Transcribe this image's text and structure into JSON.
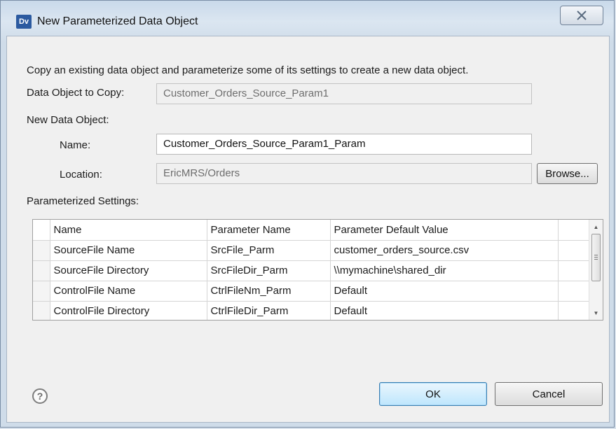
{
  "window": {
    "title": "New Parameterized Data Object",
    "app_icon_text": "Dv",
    "close_glyph": "X"
  },
  "dialog": {
    "description": "Copy an existing data object and parameterize some of its settings to create a new data object.",
    "copy_label": "Data Object to Copy:",
    "copy_value": "Customer_Orders_Source_Param1",
    "new_section_label": "New Data Object:",
    "name_label": "Name:",
    "name_value": "Customer_Orders_Source_Param1_Param",
    "location_label": "Location:",
    "location_value": "EricMRS/Orders",
    "browse_label": "Browse...",
    "settings_label": "Parameterized Settings:"
  },
  "table": {
    "columns": [
      "Name",
      "Parameter Name",
      "Parameter Default Value"
    ],
    "rows": [
      [
        "SourceFile Name",
        "SrcFile_Parm",
        "customer_orders_source.csv"
      ],
      [
        "SourceFile Directory",
        "SrcFileDir_Parm",
        "\\\\mymachine\\shared_dir"
      ],
      [
        "ControlFile Name",
        "CtrlFileNm_Parm",
        "Default"
      ],
      [
        "ControlFile Directory",
        "CtrlFileDir_Parm",
        "Default"
      ]
    ]
  },
  "footer": {
    "help_icon": "help-icon",
    "ok_label": "OK",
    "cancel_label": "Cancel"
  }
}
